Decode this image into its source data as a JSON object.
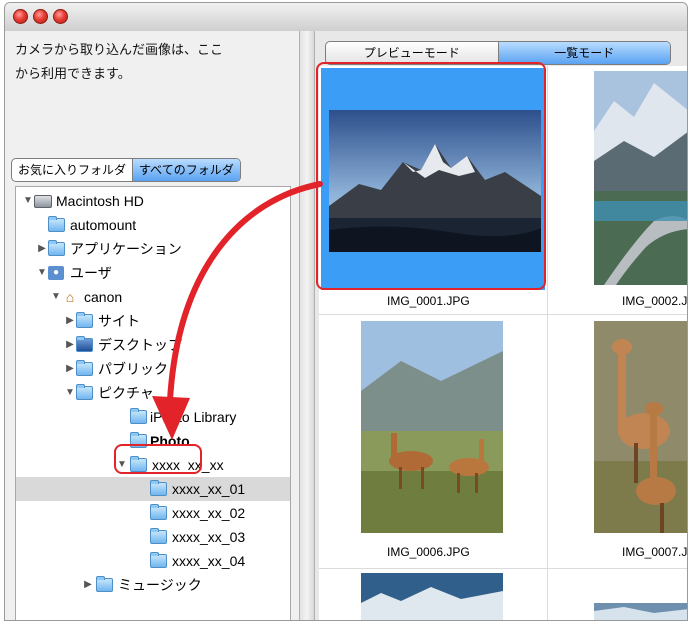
{
  "window": {
    "traffic_lights": [
      "close-button",
      "minimize-button",
      "zoom-button"
    ]
  },
  "left_pane": {
    "description": "カメラから取り込んだ画像は、ここから利用できます。",
    "description_line1": "カメラから取り込んだ画像は、ここ",
    "description_line2": "から利用できます。",
    "folder_tabs": {
      "favorites": "お気に入りフォルダ",
      "all": "すべてのフォルダ",
      "selected": "all"
    },
    "tree": [
      {
        "label": "Macintosh HD",
        "icon": "hard-drive-icon",
        "expanded": true
      },
      {
        "label": "automount",
        "icon": "folder-icon"
      },
      {
        "label": "アプリケーション",
        "icon": "applications-folder-icon",
        "expanded": false
      },
      {
        "label": "ユーザ",
        "icon": "users-folder-icon",
        "expanded": true
      },
      {
        "label": "canon",
        "icon": "home-folder-icon",
        "expanded": true
      },
      {
        "label": "サイト",
        "icon": "folder-icon",
        "expanded": false
      },
      {
        "label": "デスクトップ",
        "icon": "desktop-folder-icon",
        "expanded": false
      },
      {
        "label": "パブリック",
        "icon": "public-folder-icon",
        "expanded": false
      },
      {
        "label": "ピクチャ",
        "icon": "pictures-folder-icon",
        "expanded": true
      },
      {
        "label": "iPhoto Library",
        "icon": "folder-icon"
      },
      {
        "label": "Photo",
        "icon": "folder-icon"
      },
      {
        "label": "xxxx_xx_xx",
        "icon": "folder-icon",
        "expanded": true
      },
      {
        "label": "xxxx_xx_01",
        "icon": "folder-icon",
        "selected": true
      },
      {
        "label": "xxxx_xx_02",
        "icon": "folder-icon"
      },
      {
        "label": "xxxx_xx_03",
        "icon": "folder-icon"
      },
      {
        "label": "xxxx_xx_04",
        "icon": "folder-icon"
      },
      {
        "label": "ミュージック",
        "icon": "music-folder-icon",
        "expanded": false
      }
    ]
  },
  "right_pane": {
    "mode_tabs": {
      "preview": "プレビューモード",
      "list": "一覧モード",
      "selected": "list"
    },
    "thumbnails": [
      {
        "caption": "IMG_0001.JPG",
        "selected": true
      },
      {
        "caption": "IMG_0002.J"
      },
      {
        "caption": "IMG_0006.JPG"
      },
      {
        "caption": "IMG_0007.J"
      }
    ]
  },
  "colors": {
    "selection_blue": "#3b9df5",
    "callout_red": "#e2232a",
    "segment_active": "#5aa2f2"
  }
}
